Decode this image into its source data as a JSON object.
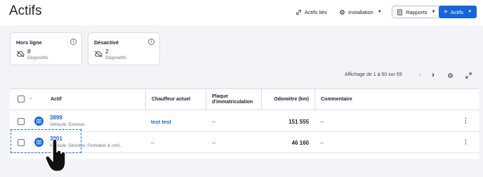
{
  "header": {
    "title": "Actifs",
    "linked_assets_label": "Actifs liés",
    "installation_label": "Installation",
    "reports_label": "Rapports",
    "add_assets_label": "Actifs"
  },
  "cards": [
    {
      "title": "Hors ligne",
      "count": "8",
      "subtitle": "Dispositifs"
    },
    {
      "title": "Désactivé",
      "count": "2",
      "subtitle": "Dispositifs"
    }
  ],
  "pager": {
    "text": "Affichage de 1 à 50 sur 69"
  },
  "table": {
    "columns": {
      "asset": "Actif",
      "driver": "Chauffeur actuel",
      "plate_line1": "Plaque",
      "plate_line2": "d'immatriculation",
      "odometer": "Odomètre (km)",
      "comment": "Commentaire"
    },
    "rows": [
      {
        "id": "3899",
        "desc": "Véhicule, Essence",
        "driver": "test test",
        "plate": "--",
        "odometer": "151 555",
        "comment": "--"
      },
      {
        "id": "3901",
        "desc": "Véhicule, Direction, Formation & conf...",
        "driver": "--",
        "plate": "--",
        "odometer": "46 160",
        "comment": "--"
      }
    ]
  },
  "colors": {
    "accent": "#1565d8",
    "background": "#f3f4f7"
  }
}
